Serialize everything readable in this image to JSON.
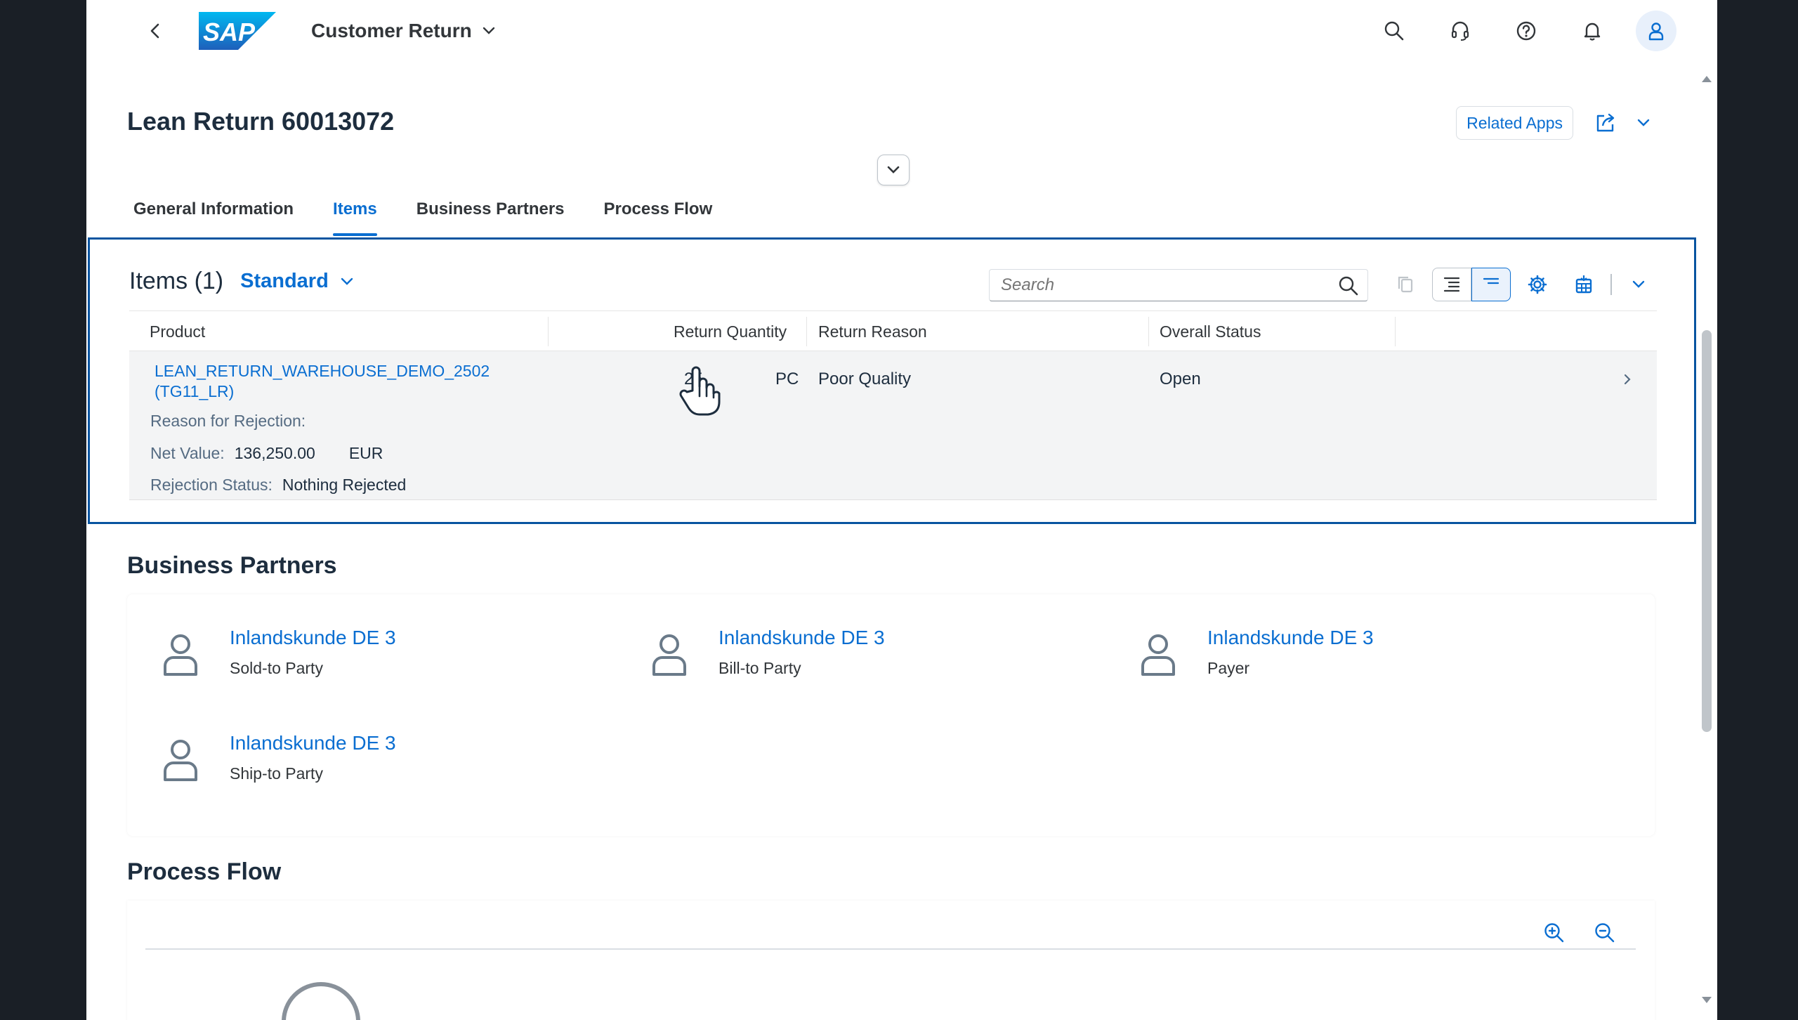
{
  "shell": {
    "app_title": "Customer Return",
    "logo_text": "SAP"
  },
  "header": {
    "title": "Lean Return 60013072",
    "related_apps": "Related Apps"
  },
  "tabs": [
    {
      "label": "General Information"
    },
    {
      "label": "Items"
    },
    {
      "label": "Business Partners"
    },
    {
      "label": "Process Flow"
    }
  ],
  "items": {
    "title": "Items (1)",
    "variant": "Standard",
    "search_placeholder": "Search",
    "columns": [
      "Product",
      "Return Quantity",
      "Return Reason",
      "Overall Status"
    ],
    "rows": [
      {
        "product": "LEAN_RETURN_WAREHOUSE_DEMO_2502 (TG11_LR)",
        "quantity": "25",
        "unit": "PC",
        "reason": "Poor Quality",
        "status": "Open",
        "reason_for_rejection_label": "Reason for Rejection:",
        "net_value_label": "Net Value:",
        "net_value": "136,250.00",
        "currency": "EUR",
        "rejection_status_label": "Rejection Status:",
        "rejection_status": "Nothing Rejected"
      }
    ]
  },
  "business_partners": {
    "title": "Business Partners",
    "partners": [
      {
        "name": "Inlandskunde DE 3",
        "role": "Sold-to Party"
      },
      {
        "name": "Inlandskunde DE 3",
        "role": "Bill-to Party"
      },
      {
        "name": "Inlandskunde DE 3",
        "role": "Payer"
      },
      {
        "name": "Inlandskunde DE 3",
        "role": "Ship-to Party"
      }
    ]
  },
  "process_flow": {
    "title": "Process Flow"
  },
  "colors": {
    "accent": "#0a6ed1",
    "focus_border": "#0854a0",
    "text": "#1d2d3e"
  }
}
